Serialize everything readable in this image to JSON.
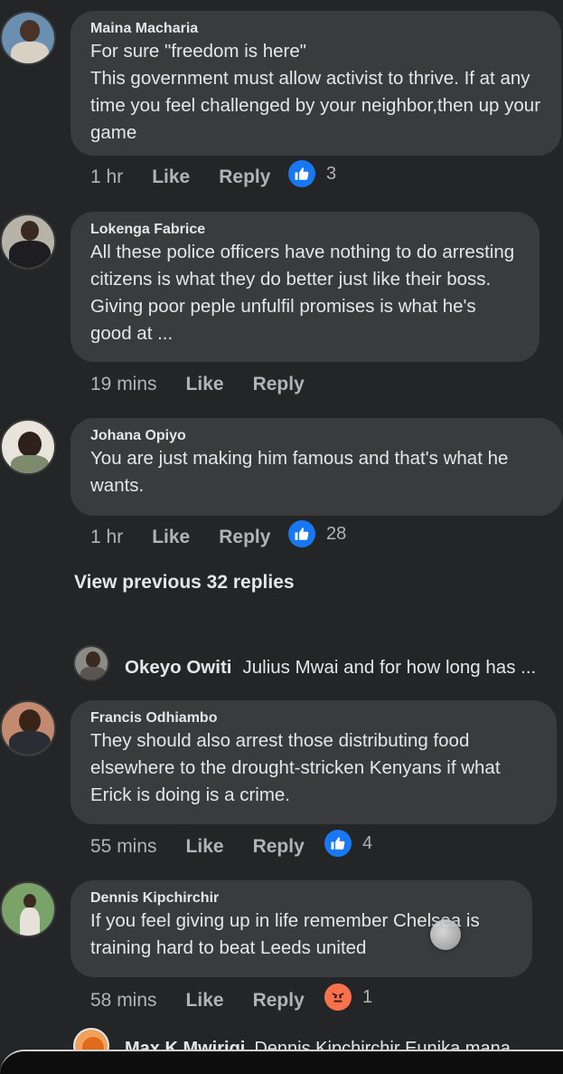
{
  "colors": {
    "background": "#242526",
    "bubble": "#3a3b3c",
    "like_blue": "#1877f2",
    "angry_orange": "#f7714c"
  },
  "comments": [
    {
      "name": "Maina Macharia",
      "text": "For sure \"freedom is here\"\nThis government must allow activist to thrive. If at any time you feel challenged by your neighbor,then up your game",
      "time": "1 hr",
      "like": "Like",
      "reply": "Reply",
      "reaction": {
        "icon": "thumbs-up-icon",
        "count": "3"
      }
    },
    {
      "name": "Lokenga Fabrice",
      "text": "All these police officers have nothing to do arresting citizens is what they do better just like their boss. Giving poor peple unfulfil promises is what he's good at ...",
      "time": "19 mins",
      "like": "Like",
      "reply": "Reply"
    },
    {
      "name": "Johana Opiyo",
      "text": "You are just making him famous and that's what he wants.",
      "time": "1 hr",
      "like": "Like",
      "reply": "Reply",
      "reaction": {
        "icon": "thumbs-up-icon",
        "count": "28"
      }
    },
    {
      "name": "Francis Odhiambo",
      "text": "They should also arrest those distributing food elsewhere to the drought-stricken Kenyans if what Erick is doing is a crime.",
      "time": "55 mins",
      "like": "Like",
      "reply": "Reply",
      "reaction": {
        "icon": "thumbs-up-icon",
        "count": "4"
      }
    },
    {
      "name": "Dennis Kipchirchir",
      "text": "If you feel giving up in life remember Chelsea is training hard to beat Leeds united",
      "time": "58 mins",
      "like": "Like",
      "reply": "Reply",
      "reaction": {
        "icon": "angry-face-icon",
        "count": "1"
      }
    }
  ],
  "view_previous": "View previous 32 replies",
  "inline_reply": {
    "name": "Okeyo Owiti",
    "text": "Julius Mwai and for how long has ..."
  },
  "cut_off": {
    "name": "Max K Mwirigi",
    "text": "Dennis Kipchirchir Eunika mana"
  }
}
